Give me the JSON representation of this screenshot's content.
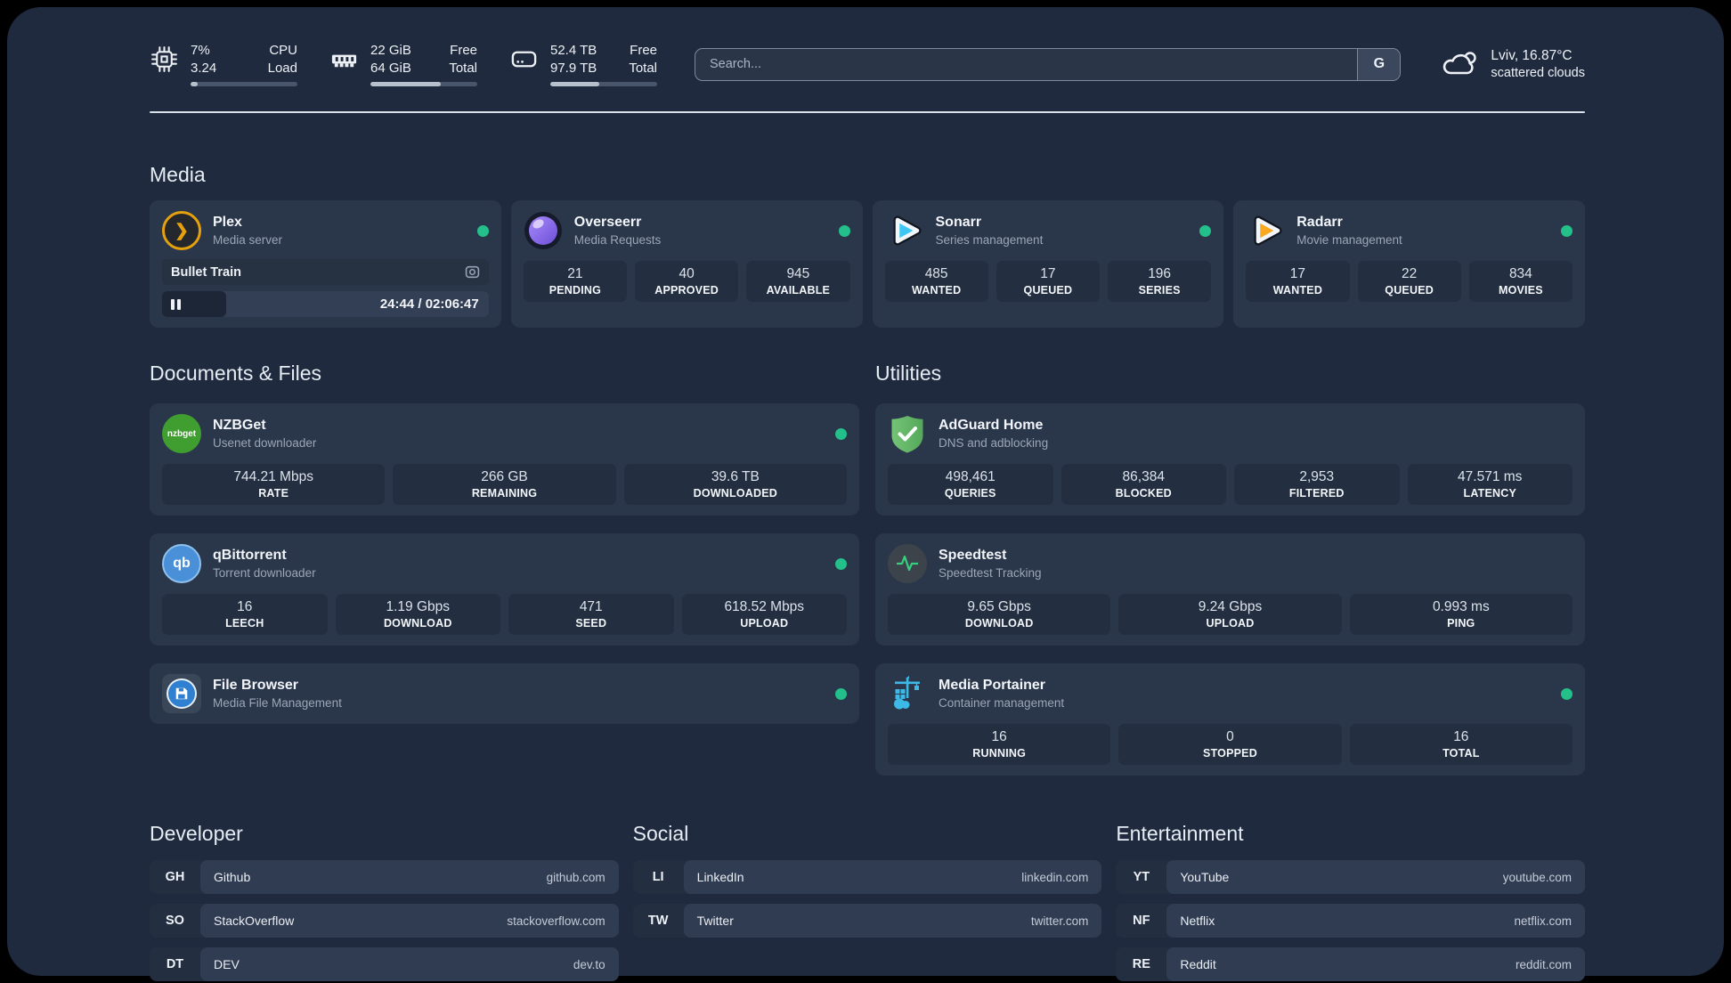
{
  "colors": {
    "panel_bg": "#1f2a3e",
    "card_bg": "#2a3649",
    "stat_bg": "#232e41",
    "status_online": "#23c08b",
    "plex_orange": "#e5a00d",
    "sonarr_blue": "#3ec6f4",
    "radarr_orange": "#f8a91f",
    "nzbget_green": "#3f9e2f",
    "qbittorrent_blue": "#4a90d9",
    "adguard_green": "#68bb6a",
    "speedtest_green": "#35d07f",
    "portainer_blue": "#3db9e8",
    "filebrowser_blue": "#2f80d0"
  },
  "header": {
    "system_stats": [
      {
        "icon": "cpu-icon",
        "value_top": "7%",
        "value_bottom": "3.24",
        "label_top": "CPU",
        "label_bottom": "Load",
        "progress_pct": 7
      },
      {
        "icon": "ram-icon",
        "value_top": "22 GiB",
        "value_bottom": "64 GiB",
        "label_top": "Free",
        "label_bottom": "Total",
        "progress_pct": 66
      },
      {
        "icon": "disk-icon",
        "value_top": "52.4 TB",
        "value_bottom": "97.9 TB",
        "label_top": "Free",
        "label_bottom": "Total",
        "progress_pct": 46
      }
    ],
    "search": {
      "placeholder": "Search...",
      "button": "G"
    },
    "weather": {
      "icon": "cloud-icon",
      "line1": "Lviv, 16.87°C",
      "line2": "scattered clouds"
    }
  },
  "media": {
    "title": "Media",
    "plex": {
      "name": "Plex",
      "subtitle": "Media server",
      "online": true,
      "now_playing": "Bullet Train",
      "time": "24:44 / 02:06:47",
      "progress_pct": 19.5
    },
    "overseerr": {
      "name": "Overseerr",
      "subtitle": "Media Requests",
      "online": true,
      "stats": [
        {
          "value": "21",
          "label": "PENDING"
        },
        {
          "value": "40",
          "label": "APPROVED"
        },
        {
          "value": "945",
          "label": "AVAILABLE"
        }
      ]
    },
    "sonarr": {
      "name": "Sonarr",
      "subtitle": "Series management",
      "online": true,
      "stats": [
        {
          "value": "485",
          "label": "WANTED"
        },
        {
          "value": "17",
          "label": "QUEUED"
        },
        {
          "value": "196",
          "label": "SERIES"
        }
      ]
    },
    "radarr": {
      "name": "Radarr",
      "subtitle": "Movie management",
      "online": true,
      "stats": [
        {
          "value": "17",
          "label": "WANTED"
        },
        {
          "value": "22",
          "label": "QUEUED"
        },
        {
          "value": "834",
          "label": "MOVIES"
        }
      ]
    }
  },
  "documents": {
    "title": "Documents & Files",
    "nzbget": {
      "name": "NZBGet",
      "subtitle": "Usenet downloader",
      "online": true,
      "icon_text": "nzbget",
      "stats": [
        {
          "value": "744.21 Mbps",
          "label": "RATE"
        },
        {
          "value": "266 GB",
          "label": "REMAINING"
        },
        {
          "value": "39.6 TB",
          "label": "DOWNLOADED"
        }
      ]
    },
    "qbittorrent": {
      "name": "qBittorrent",
      "subtitle": "Torrent downloader",
      "online": true,
      "icon_text": "qb",
      "stats": [
        {
          "value": "16",
          "label": "LEECH"
        },
        {
          "value": "1.19 Gbps",
          "label": "DOWNLOAD"
        },
        {
          "value": "471",
          "label": "SEED"
        },
        {
          "value": "618.52 Mbps",
          "label": "UPLOAD"
        }
      ]
    },
    "filebrowser": {
      "name": "File Browser",
      "subtitle": "Media File Management",
      "online": true
    }
  },
  "utilities": {
    "title": "Utilities",
    "adguard": {
      "name": "AdGuard Home",
      "subtitle": "DNS and adblocking",
      "stats": [
        {
          "value": "498,461",
          "label": "QUERIES"
        },
        {
          "value": "86,384",
          "label": "BLOCKED"
        },
        {
          "value": "2,953",
          "label": "FILTERED"
        },
        {
          "value": "47.571 ms",
          "label": "LATENCY"
        }
      ]
    },
    "speedtest": {
      "name": "Speedtest",
      "subtitle": "Speedtest Tracking",
      "stats": [
        {
          "value": "9.65 Gbps",
          "label": "DOWNLOAD"
        },
        {
          "value": "9.24 Gbps",
          "label": "UPLOAD"
        },
        {
          "value": "0.993 ms",
          "label": "PING"
        }
      ]
    },
    "portainer": {
      "name": "Media Portainer",
      "subtitle": "Container management",
      "online": true,
      "stats": [
        {
          "value": "16",
          "label": "RUNNING"
        },
        {
          "value": "0",
          "label": "STOPPED"
        },
        {
          "value": "16",
          "label": "TOTAL"
        }
      ]
    }
  },
  "bookmarks": [
    {
      "title": "Developer",
      "links": [
        {
          "abbr": "GH",
          "name": "Github",
          "url": "github.com"
        },
        {
          "abbr": "SO",
          "name": "StackOverflow",
          "url": "stackoverflow.com"
        },
        {
          "abbr": "DT",
          "name": "DEV",
          "url": "dev.to"
        }
      ]
    },
    {
      "title": "Social",
      "links": [
        {
          "abbr": "LI",
          "name": "LinkedIn",
          "url": "linkedin.com"
        },
        {
          "abbr": "TW",
          "name": "Twitter",
          "url": "twitter.com"
        }
      ]
    },
    {
      "title": "Entertainment",
      "links": [
        {
          "abbr": "YT",
          "name": "YouTube",
          "url": "youtube.com"
        },
        {
          "abbr": "NF",
          "name": "Netflix",
          "url": "netflix.com"
        },
        {
          "abbr": "RE",
          "name": "Reddit",
          "url": "reddit.com"
        }
      ]
    }
  ]
}
